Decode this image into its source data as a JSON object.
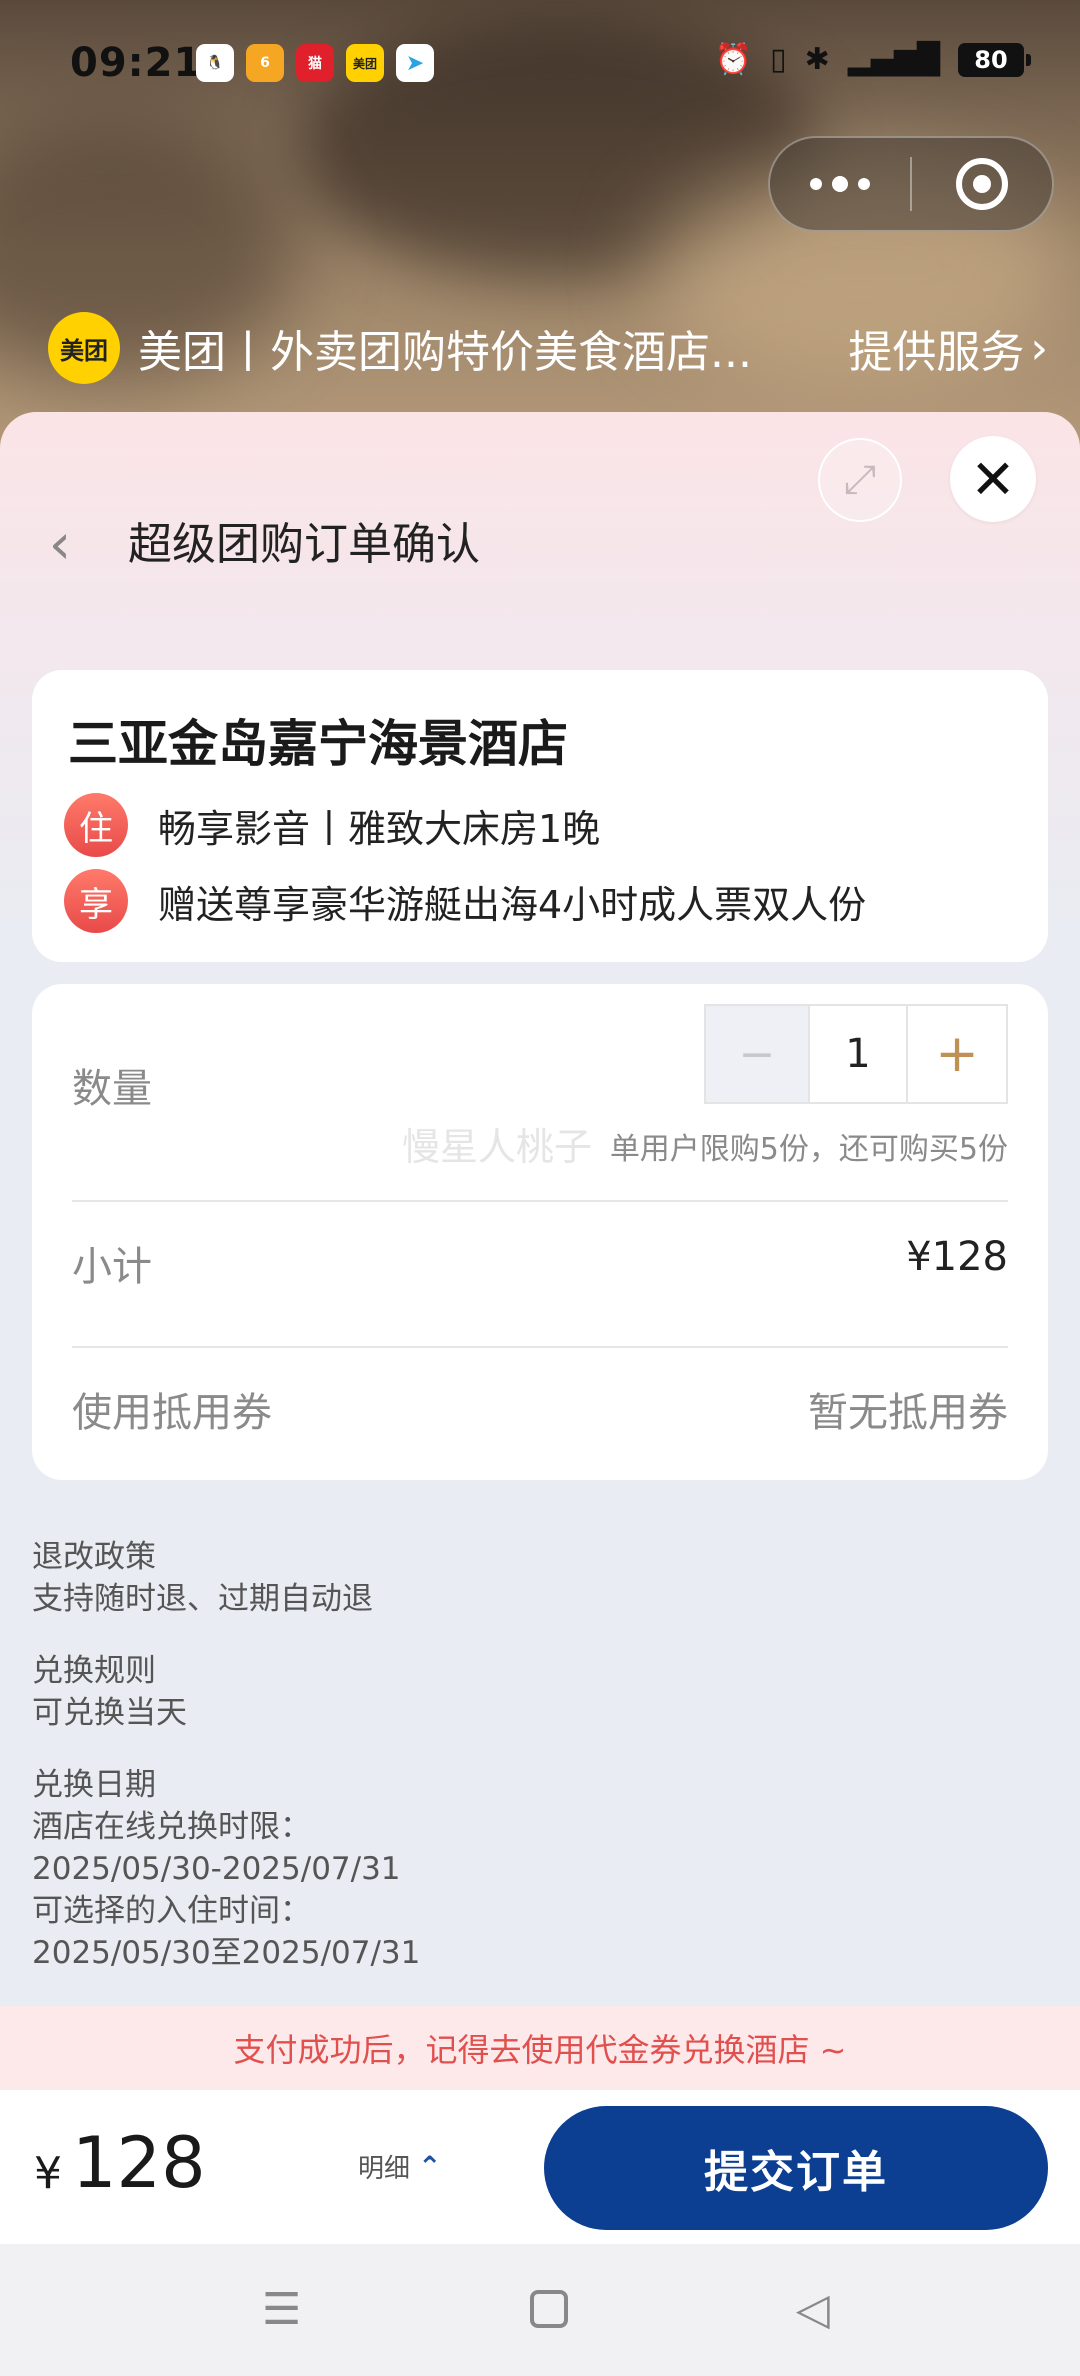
{
  "status_bar": {
    "time": "09:21",
    "battery": "80",
    "app_icons": [
      "qq-icon",
      "taobao-618-icon",
      "tmall-618-icon",
      "meituan-icon",
      "telegram-icon"
    ],
    "right_icons": [
      "alarm-icon",
      "vibrate-icon",
      "bluetooth-icon",
      "5g-signal-icon"
    ]
  },
  "merchant": {
    "logo_text": "美团",
    "name": "美团丨外卖团购特价美食酒店...",
    "service_label": "提供服务",
    "chevron": "›"
  },
  "header": {
    "back_glyph": "‹",
    "title": "超级团购订单确认",
    "close_glyph": "✕",
    "expand_glyph": "⤢"
  },
  "hotel": {
    "name": "三亚金岛嘉宁海景酒店",
    "perks": [
      {
        "badge": "住",
        "text": "畅享影音丨雅致大床房1晚"
      },
      {
        "badge": "享",
        "text": "赠送尊享豪华游艇出海4小时成人票双人份"
      }
    ]
  },
  "order": {
    "quantity_label": "数量",
    "quantity_minus": "−",
    "quantity_value": "1",
    "quantity_plus": "+",
    "limit_note": "单用户限购5份，还可购买5份",
    "watermark": "慢星人桃子",
    "subtotal_label": "小计",
    "subtotal_value": "¥128",
    "coupon_label": "使用抵用券",
    "coupon_value": "暂无抵用券"
  },
  "policy": {
    "refund_title": "退改政策",
    "refund_text": "支持随时退、过期自动退",
    "exchange_title": "兑换规则",
    "exchange_text": "可兑换当天",
    "date_title": "兑换日期",
    "date_line1": "酒店在线兑换时限：",
    "date_line2": "2025/05/30-2025/07/31",
    "date_line3": "可选择的入住时间：",
    "date_line4": "2025/05/30至2025/07/31"
  },
  "tip": "支付成功后，记得去使用代金券兑换酒店 ~",
  "pay": {
    "currency": "¥",
    "price": "128",
    "detail_label": "明细",
    "detail_chevron": "⌃",
    "submit_label": "提交订单"
  },
  "nav": {
    "menu_glyph": "☰",
    "back_glyph": "◁"
  },
  "colors": {
    "primary": "#0c3e92",
    "accent_red": "#e84a4a",
    "plus_gold": "#c09155",
    "tip_text": "#e0504e",
    "meituan_yellow": "#ffd100"
  }
}
